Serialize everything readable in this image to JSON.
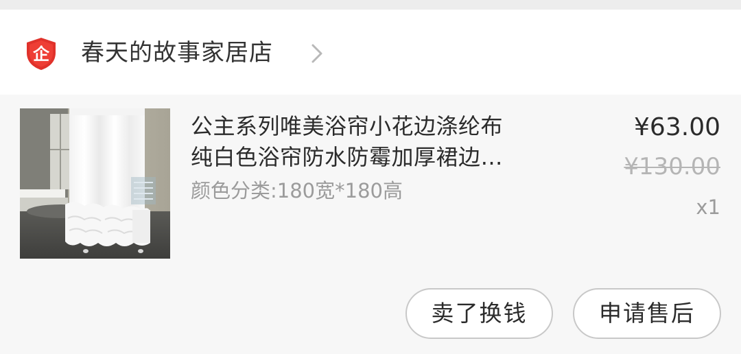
{
  "shop": {
    "name": "春天的故事家居店",
    "badge_icon": "enterprise-shield-icon",
    "badge_text": "企",
    "badge_color": "#e0322b",
    "chevron_icon": "chevron-right-icon"
  },
  "item": {
    "title_line1": "公主系列唯美浴帘小花边涤纶布",
    "title_line2": "纯白色浴帘防水防霉加厚裙边…",
    "spec": "颜色分类:180宽*180高",
    "price": "¥63.00",
    "original_price": "¥130.00",
    "quantity": "x1",
    "image_icon": "white-ruffle-shower-curtain-photo"
  },
  "actions": {
    "sell_label": "卖了换钱",
    "after_sale_label": "申请售后"
  }
}
